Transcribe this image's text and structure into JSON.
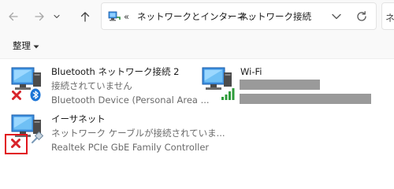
{
  "navigation": {
    "back_icon": "arrow-left-icon",
    "forward_icon": "arrow-right-icon",
    "recent_icon": "chevron-down-icon",
    "up_icon": "arrow-up-icon"
  },
  "address": {
    "overflow": "«",
    "segments": [
      "ネットワークとインターネ...",
      "ネットワーク接続"
    ],
    "separator": "›",
    "refresh_icon": "refresh-icon",
    "dropdown_icon": "chevron-down-icon"
  },
  "search": {
    "glyph": "ネ"
  },
  "toolbar": {
    "organize_label": "整理",
    "organize_caret": "▾"
  },
  "connections": [
    {
      "title": "Bluetooth ネットワーク接続 2",
      "status": "接続されていません",
      "device": "Bluetooth Device (Personal Area ...",
      "status_icon": "error-x-icon",
      "badge_icon": "bluetooth-icon"
    },
    {
      "title": "Wi-Fi",
      "status": "",
      "device": "",
      "status_icon": "signal-bars-icon"
    },
    {
      "title": "イーサネット",
      "status": "ネットワーク ケーブルが接続されていま...",
      "device": "Realtek PCIe GbE Family Controller",
      "status_icon": "error-x-icon",
      "badge_icon": "ethernet-cable-icon"
    }
  ],
  "colors": {
    "accent_blue": "#1b74d6",
    "error_red": "#d8232a",
    "highlight_red": "#e1141c",
    "signal_green": "#2f9c3b",
    "redaction_gray": "#9a9a9a"
  }
}
